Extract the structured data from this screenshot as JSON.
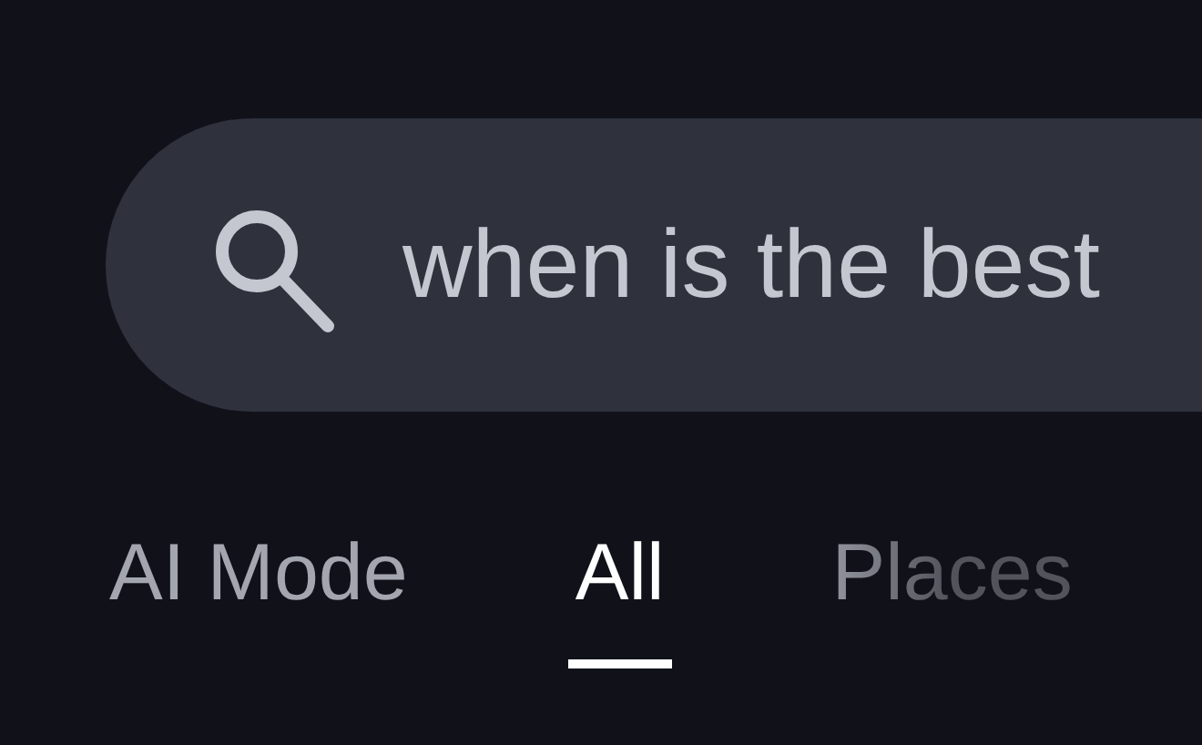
{
  "search": {
    "value": "when is the best"
  },
  "tabs": [
    {
      "label": "AI Mode",
      "selected": false
    },
    {
      "label": "All",
      "selected": true
    },
    {
      "label": "Places",
      "selected": false
    }
  ]
}
